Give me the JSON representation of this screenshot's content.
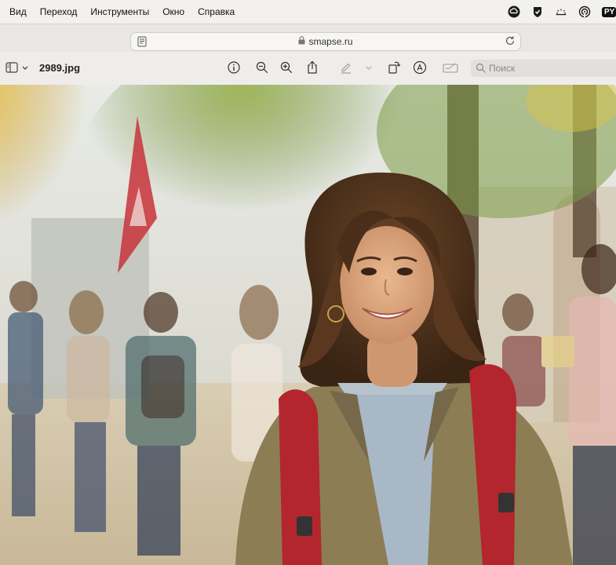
{
  "menubar": {
    "items": [
      "Вид",
      "Переход",
      "Инструменты",
      "Окно",
      "Справка"
    ],
    "status_badge": "PY"
  },
  "urlbar": {
    "domain": "smapse.ru"
  },
  "toolbar": {
    "title": "2989.jpg",
    "search_placeholder": "Поиск"
  },
  "colors": {
    "menubar_bg": "#f3f1ee",
    "toolbar_bg": "#efedeb",
    "backpack": "#b3262d",
    "jacket": "#8a7a52"
  },
  "photo": {
    "subject": "smiling student with red backpack"
  }
}
